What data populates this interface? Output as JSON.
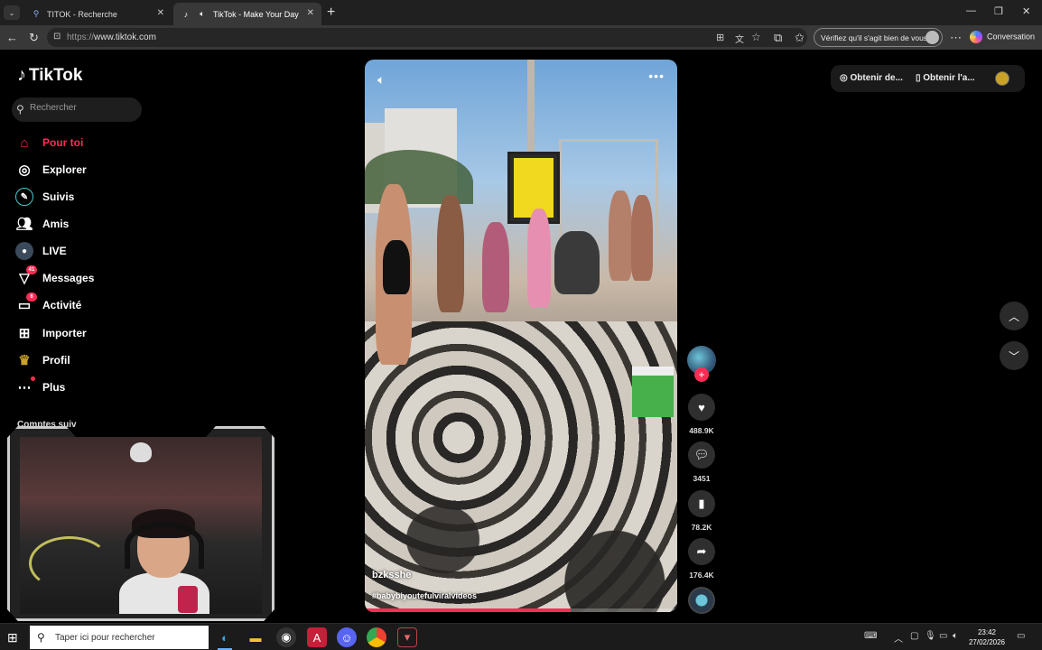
{
  "browser": {
    "tabs": [
      {
        "title": "TITOK - Recherche",
        "icon": "search-icon",
        "active": false
      },
      {
        "title": "TikTok - Make Your Day",
        "icon": "tiktok-icon",
        "active": true
      }
    ],
    "url_protocol": "https://",
    "url_host": "www.tiktok.com",
    "verify_pill": "Vérifiez qu'il s'agit bien de vous",
    "copilot_label": "Conversation"
  },
  "tiktok": {
    "logo_text": "TikTok",
    "search_placeholder": "Rechercher",
    "nav": [
      {
        "label": "Pour toi",
        "icon": "home-icon",
        "active": true
      },
      {
        "label": "Explorer",
        "icon": "compass-icon"
      },
      {
        "label": "Suivis",
        "icon": "following-icon"
      },
      {
        "label": "Amis",
        "icon": "friends-icon"
      },
      {
        "label": "LIVE",
        "icon": "live-icon"
      },
      {
        "label": "Messages",
        "icon": "messages-icon",
        "badge": "41"
      },
      {
        "label": "Activité",
        "icon": "activity-icon",
        "badge": "6"
      },
      {
        "label": "Importer",
        "icon": "upload-icon"
      },
      {
        "label": "Profil",
        "icon": "profile-icon"
      },
      {
        "label": "Plus",
        "icon": "more-icon",
        "dot": true
      }
    ],
    "following_accounts_label": "Comptes suiv",
    "video": {
      "author": "bzksshe",
      "hashtags": "#babybiyoutefulviralvideos",
      "progress": 0.66
    },
    "actions": {
      "likes": "488.9K",
      "comments": "3451",
      "saves": "78.2K",
      "shares": "176.4K"
    },
    "top_right": {
      "get_coins": "Obtenir de...",
      "get_app": "Obtenir l'a..."
    }
  },
  "taskbar": {
    "search_placeholder": "Taper ici pour rechercher",
    "time": "23:42",
    "date": "27/02/2026"
  },
  "colors": {
    "accent": "#fe2c55",
    "background": "#000000",
    "chrome": "#202020"
  }
}
